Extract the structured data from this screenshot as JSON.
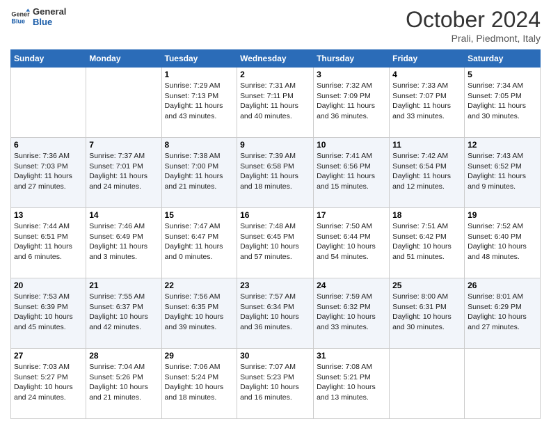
{
  "header": {
    "logo_general": "General",
    "logo_blue": "Blue",
    "month": "October 2024",
    "location": "Prali, Piedmont, Italy"
  },
  "columns": [
    "Sunday",
    "Monday",
    "Tuesday",
    "Wednesday",
    "Thursday",
    "Friday",
    "Saturday"
  ],
  "rows": [
    [
      {
        "day": "",
        "info": ""
      },
      {
        "day": "",
        "info": ""
      },
      {
        "day": "1",
        "info": "Sunrise: 7:29 AM\nSunset: 7:13 PM\nDaylight: 11 hours and 43 minutes."
      },
      {
        "day": "2",
        "info": "Sunrise: 7:31 AM\nSunset: 7:11 PM\nDaylight: 11 hours and 40 minutes."
      },
      {
        "day": "3",
        "info": "Sunrise: 7:32 AM\nSunset: 7:09 PM\nDaylight: 11 hours and 36 minutes."
      },
      {
        "day": "4",
        "info": "Sunrise: 7:33 AM\nSunset: 7:07 PM\nDaylight: 11 hours and 33 minutes."
      },
      {
        "day": "5",
        "info": "Sunrise: 7:34 AM\nSunset: 7:05 PM\nDaylight: 11 hours and 30 minutes."
      }
    ],
    [
      {
        "day": "6",
        "info": "Sunrise: 7:36 AM\nSunset: 7:03 PM\nDaylight: 11 hours and 27 minutes."
      },
      {
        "day": "7",
        "info": "Sunrise: 7:37 AM\nSunset: 7:01 PM\nDaylight: 11 hours and 24 minutes."
      },
      {
        "day": "8",
        "info": "Sunrise: 7:38 AM\nSunset: 7:00 PM\nDaylight: 11 hours and 21 minutes."
      },
      {
        "day": "9",
        "info": "Sunrise: 7:39 AM\nSunset: 6:58 PM\nDaylight: 11 hours and 18 minutes."
      },
      {
        "day": "10",
        "info": "Sunrise: 7:41 AM\nSunset: 6:56 PM\nDaylight: 11 hours and 15 minutes."
      },
      {
        "day": "11",
        "info": "Sunrise: 7:42 AM\nSunset: 6:54 PM\nDaylight: 11 hours and 12 minutes."
      },
      {
        "day": "12",
        "info": "Sunrise: 7:43 AM\nSunset: 6:52 PM\nDaylight: 11 hours and 9 minutes."
      }
    ],
    [
      {
        "day": "13",
        "info": "Sunrise: 7:44 AM\nSunset: 6:51 PM\nDaylight: 11 hours and 6 minutes."
      },
      {
        "day": "14",
        "info": "Sunrise: 7:46 AM\nSunset: 6:49 PM\nDaylight: 11 hours and 3 minutes."
      },
      {
        "day": "15",
        "info": "Sunrise: 7:47 AM\nSunset: 6:47 PM\nDaylight: 11 hours and 0 minutes."
      },
      {
        "day": "16",
        "info": "Sunrise: 7:48 AM\nSunset: 6:45 PM\nDaylight: 10 hours and 57 minutes."
      },
      {
        "day": "17",
        "info": "Sunrise: 7:50 AM\nSunset: 6:44 PM\nDaylight: 10 hours and 54 minutes."
      },
      {
        "day": "18",
        "info": "Sunrise: 7:51 AM\nSunset: 6:42 PM\nDaylight: 10 hours and 51 minutes."
      },
      {
        "day": "19",
        "info": "Sunrise: 7:52 AM\nSunset: 6:40 PM\nDaylight: 10 hours and 48 minutes."
      }
    ],
    [
      {
        "day": "20",
        "info": "Sunrise: 7:53 AM\nSunset: 6:39 PM\nDaylight: 10 hours and 45 minutes."
      },
      {
        "day": "21",
        "info": "Sunrise: 7:55 AM\nSunset: 6:37 PM\nDaylight: 10 hours and 42 minutes."
      },
      {
        "day": "22",
        "info": "Sunrise: 7:56 AM\nSunset: 6:35 PM\nDaylight: 10 hours and 39 minutes."
      },
      {
        "day": "23",
        "info": "Sunrise: 7:57 AM\nSunset: 6:34 PM\nDaylight: 10 hours and 36 minutes."
      },
      {
        "day": "24",
        "info": "Sunrise: 7:59 AM\nSunset: 6:32 PM\nDaylight: 10 hours and 33 minutes."
      },
      {
        "day": "25",
        "info": "Sunrise: 8:00 AM\nSunset: 6:31 PM\nDaylight: 10 hours and 30 minutes."
      },
      {
        "day": "26",
        "info": "Sunrise: 8:01 AM\nSunset: 6:29 PM\nDaylight: 10 hours and 27 minutes."
      }
    ],
    [
      {
        "day": "27",
        "info": "Sunrise: 7:03 AM\nSunset: 5:27 PM\nDaylight: 10 hours and 24 minutes."
      },
      {
        "day": "28",
        "info": "Sunrise: 7:04 AM\nSunset: 5:26 PM\nDaylight: 10 hours and 21 minutes."
      },
      {
        "day": "29",
        "info": "Sunrise: 7:06 AM\nSunset: 5:24 PM\nDaylight: 10 hours and 18 minutes."
      },
      {
        "day": "30",
        "info": "Sunrise: 7:07 AM\nSunset: 5:23 PM\nDaylight: 10 hours and 16 minutes."
      },
      {
        "day": "31",
        "info": "Sunrise: 7:08 AM\nSunset: 5:21 PM\nDaylight: 10 hours and 13 minutes."
      },
      {
        "day": "",
        "info": ""
      },
      {
        "day": "",
        "info": ""
      }
    ]
  ]
}
